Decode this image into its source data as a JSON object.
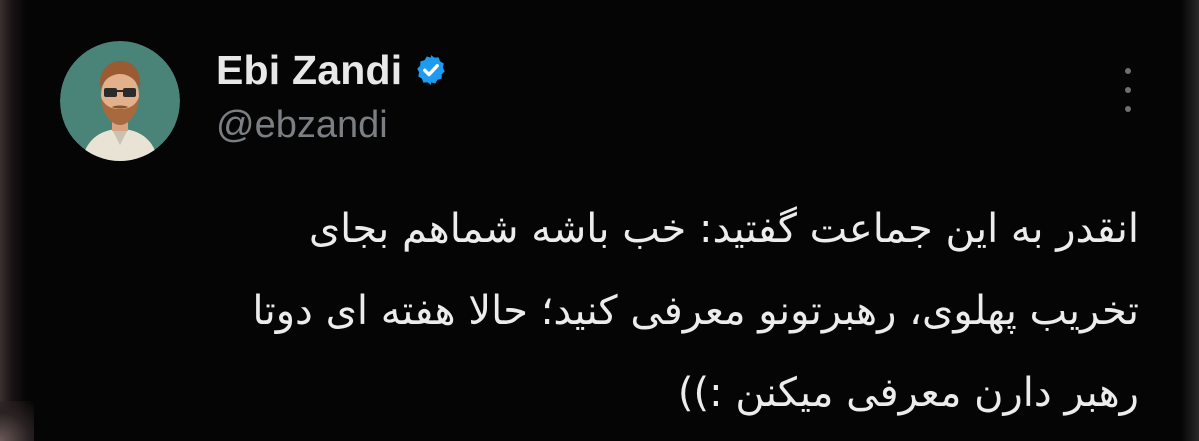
{
  "tweet": {
    "author": {
      "display_name": "Ebi Zandi",
      "handle": "@ebzandi",
      "verified": true,
      "avatar_icon": "bearded-man-avatar-icon",
      "avatar_bg": "#4a8478"
    },
    "verified_color": "#1d9bf0",
    "more_icon": "more-vertical-icon",
    "text_lines": [
      "انقدر به این جماعت گفتید: خب باشه شماهم بجای",
      "تخریب پهلوی، رهبرتونو معرفی کنید؛ حالا هفته ای دوتا",
      "رهبر دارن معرفی میکنن :))"
    ]
  }
}
